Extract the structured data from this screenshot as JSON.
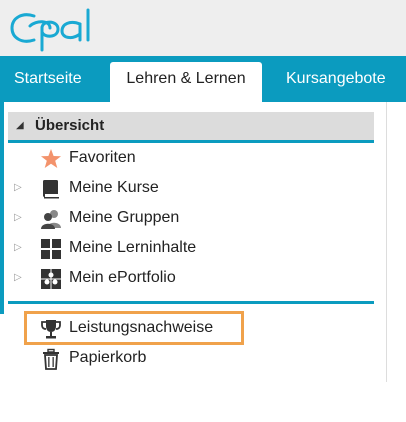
{
  "logo": {
    "text": "Opal"
  },
  "tabs": [
    {
      "label": "Startseite"
    },
    {
      "label": "Lehren & Lernen"
    },
    {
      "label": "Kursangebote"
    }
  ],
  "tree": {
    "root": {
      "label": "Übersicht",
      "expand_icon": "triangle-down-icon"
    },
    "items": [
      {
        "label": "Favoriten",
        "icon": "star-icon"
      },
      {
        "label": "Meine Kurse",
        "icon": "book-icon"
      },
      {
        "label": "Meine Gruppen",
        "icon": "group-icon"
      },
      {
        "label": "Meine Lerninhalte",
        "icon": "grid-icon"
      },
      {
        "label": "Mein ePortfolio",
        "icon": "puzzle-icon"
      }
    ],
    "bottom_items": [
      {
        "label": "Leistungsnachweise",
        "icon": "trophy-icon"
      },
      {
        "label": "Papierkorb",
        "icon": "trash-icon"
      }
    ]
  },
  "colors": {
    "accent": "#0b9bbf",
    "highlight": "#f0a24b",
    "star": "#f3936c"
  }
}
